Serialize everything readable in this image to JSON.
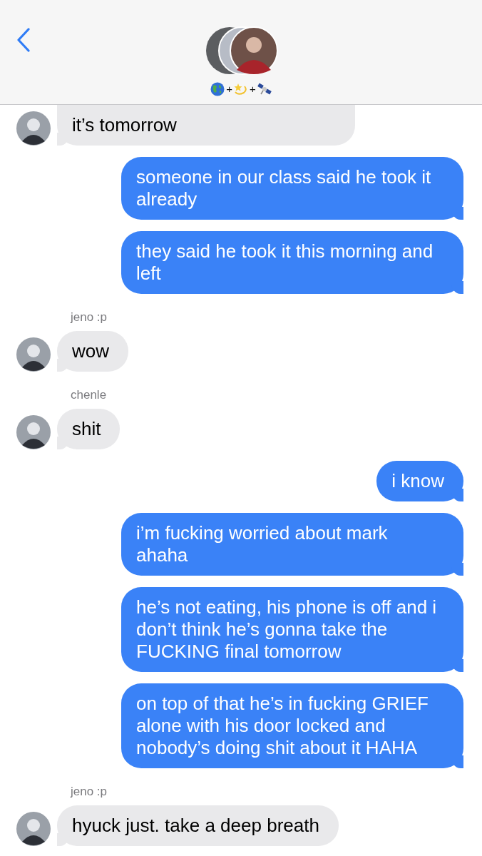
{
  "header": {
    "title": [
      {
        "kind": "icon"
      },
      {
        "kind": "text",
        "text": "+"
      },
      {
        "kind": "icon"
      },
      {
        "kind": "text",
        "text": "+"
      },
      {
        "kind": "icon"
      }
    ]
  },
  "messages": [
    {
      "kind": "received",
      "text": "it’s tomorrow",
      "cut": true
    },
    {
      "kind": "sent",
      "text": "someone in our class said he took it already"
    },
    {
      "kind": "sent",
      "text": "they said he took it this morning and left"
    },
    {
      "kind": "received",
      "sender": "jeno :p",
      "text": "wow"
    },
    {
      "kind": "received",
      "sender": "chenle",
      "text": "shit"
    },
    {
      "kind": "sent",
      "text": "i know"
    },
    {
      "kind": "sent",
      "text": "i’m fucking worried about mark ahaha"
    },
    {
      "kind": "sent",
      "text": "he’s not eating, his phone is off and i don’t think he’s gonna take the FUCKING final tomorrow"
    },
    {
      "kind": "sent",
      "text": "on top of that he’s in fucking GRIEF alone with his door locked and nobody’s doing shit about it HAHA"
    },
    {
      "kind": "received",
      "sender": "jeno :p",
      "text": "hyuck just. take a deep breath"
    }
  ]
}
